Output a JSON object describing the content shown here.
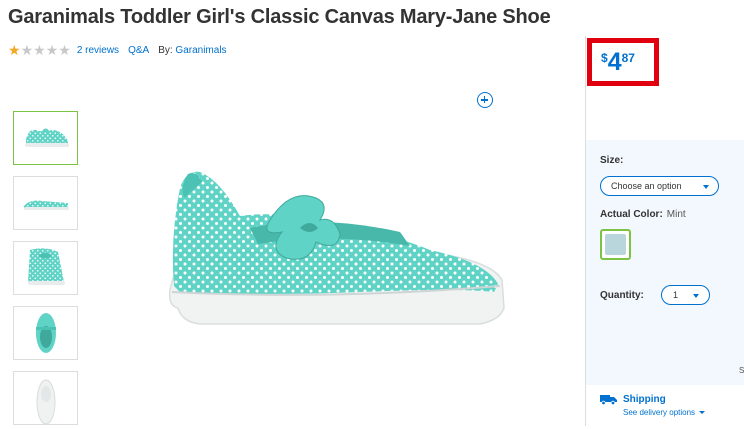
{
  "product": {
    "title": "Garanimals Toddler Girl's Classic Canvas Mary-Jane Shoe",
    "rating": 1,
    "rating_max": 5,
    "reviews_label": "2 reviews",
    "qa_label": "Q&A",
    "by_label": "By:",
    "brand": "Garanimals"
  },
  "price": {
    "currency": "$",
    "dollars": "4",
    "cents": "87",
    "highlight_color": "#e0000f"
  },
  "gallery": {
    "thumbnail_count": 5,
    "active_index": 0,
    "zoom_icon": "zoom-in-icon"
  },
  "options": {
    "size_label": "Size:",
    "size_placeholder": "Choose an option",
    "color_label": "Actual Color:",
    "color_value": "Mint",
    "quantity_label": "Quantity:",
    "quantity_value": "1"
  },
  "shipping": {
    "title": "Shipping",
    "subtitle": "See delivery options",
    "icon": "truck-icon"
  },
  "colors": {
    "accent": "#0071ce",
    "selected_border": "#7cc243",
    "panel_bg": "#f2f8fd",
    "shoe": "#5fd3c6"
  },
  "edge_text": "S"
}
